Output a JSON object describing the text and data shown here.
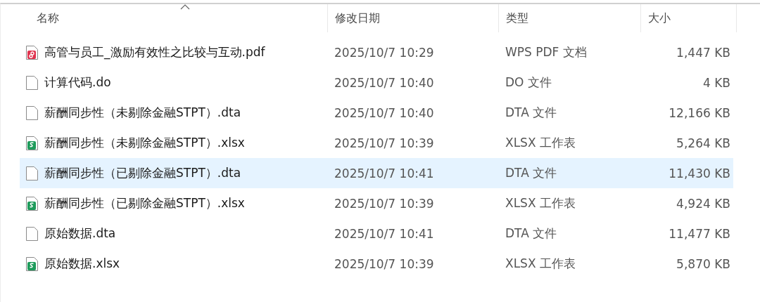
{
  "columns": [
    {
      "label": "名称",
      "sorted": true
    },
    {
      "label": "修改日期",
      "sorted": false
    },
    {
      "label": "类型",
      "sorted": false
    },
    {
      "label": "大小",
      "sorted": false
    }
  ],
  "rows": [
    {
      "kind": "pdf",
      "name": "高管与员工_激励有效性之比较与互动.pdf",
      "modified": "2025/10/7 10:29",
      "type": "WPS PDF 文档",
      "size": "1,447 KB",
      "selected": false
    },
    {
      "kind": "file",
      "name": "计算代码.do",
      "modified": "2025/10/7 10:40",
      "type": "DO 文件",
      "size": "4 KB",
      "selected": false
    },
    {
      "kind": "file",
      "name": "薪酬同步性（未剔除金融STPT）.dta",
      "modified": "2025/10/7 10:40",
      "type": "DTA 文件",
      "size": "12,166 KB",
      "selected": false
    },
    {
      "kind": "sheet",
      "name": "薪酬同步性（未剔除金融STPT）.xlsx",
      "modified": "2025/10/7 10:39",
      "type": "XLSX 工作表",
      "size": "5,264 KB",
      "selected": false
    },
    {
      "kind": "file",
      "name": "薪酬同步性（已剔除金融STPT）.dta",
      "modified": "2025/10/7 10:41",
      "type": "DTA 文件",
      "size": "11,430 KB",
      "selected": true
    },
    {
      "kind": "sheet",
      "name": "薪酬同步性（已剔除金融STPT）.xlsx",
      "modified": "2025/10/7 10:39",
      "type": "XLSX 工作表",
      "size": "4,924 KB",
      "selected": false
    },
    {
      "kind": "file",
      "name": "原始数据.dta",
      "modified": "2025/10/7 10:41",
      "type": "DTA 文件",
      "size": "11,477 KB",
      "selected": false
    },
    {
      "kind": "sheet",
      "name": "原始数据.xlsx",
      "modified": "2025/10/7 10:39",
      "type": "XLSX 工作表",
      "size": "5,870 KB",
      "selected": false
    }
  ]
}
